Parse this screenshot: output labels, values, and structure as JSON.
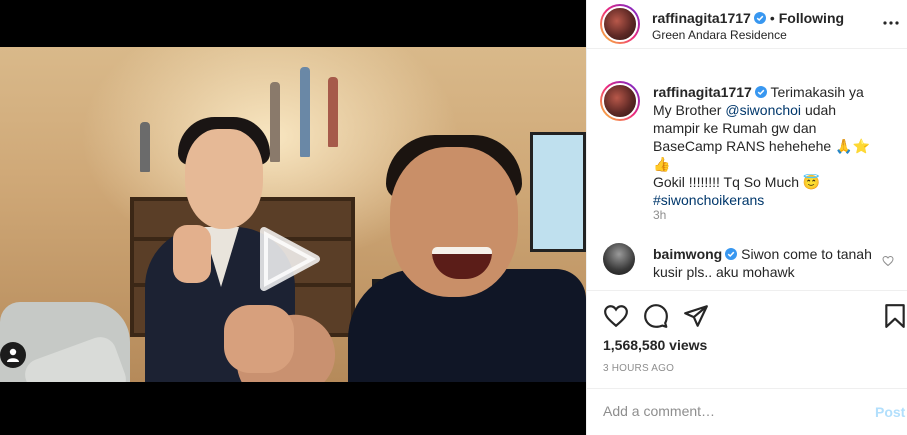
{
  "header": {
    "username": "raffinagita1717",
    "separator": "•",
    "follow_status": "Following",
    "location": "Green Andara Residence"
  },
  "caption": {
    "username": "raffinagita1717",
    "text_1": "Terimakasih ya My Brother",
    "mention": "@siwonchoi",
    "text_2": "udah mampir ke Rumah gw dan BaseCamp RANS hehehehe",
    "emoji_1": "🙏⭐👍",
    "text_3": "Gokil !!!!!!!! Tq So Much",
    "emoji_2": "😇",
    "hashtag": "#siwonchoikerans",
    "time": "3h"
  },
  "comment": {
    "username": "baimwong",
    "text": "Siwon come to tanah kusir pls.. aku mohawk"
  },
  "stats": {
    "views": "1,568,580 views",
    "posted": "3 HOURS AGO"
  },
  "add_comment": {
    "placeholder": "Add a comment…",
    "post_label": "Post"
  },
  "icons": {
    "verified": "verified-badge-icon",
    "more": "more-options-icon",
    "like": "heart-icon",
    "comment": "comment-bubble-icon",
    "share": "paper-plane-icon",
    "save": "bookmark-icon",
    "play": "play-icon",
    "tag": "user-tag-icon"
  },
  "colors": {
    "verified": "#3897f0",
    "link": "#00376b",
    "post_disabled": "#b2dffc"
  }
}
